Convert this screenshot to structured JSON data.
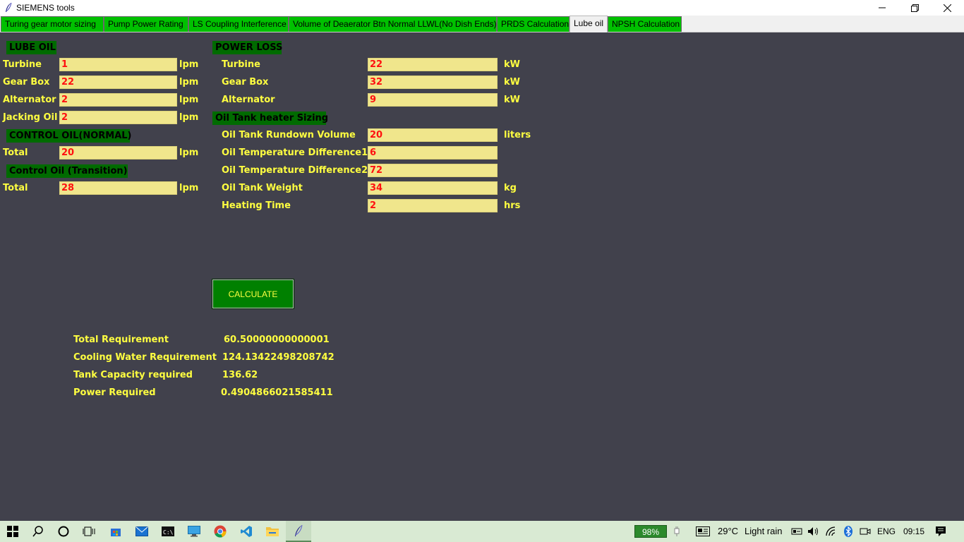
{
  "window": {
    "title": "SIEMENS tools"
  },
  "tabs": [
    "Turing gear motor sizing",
    "Pump Power Rating",
    "LS Coupling Interference",
    "Volume of Deaerator Btn Normal LLWL(No Dish Ends)",
    "PRDS Calculation",
    "Lube oil",
    "NPSH Calculation"
  ],
  "lube_oil": {
    "header": "LUBE OIL",
    "rows": [
      {
        "label": "Turbine",
        "value": "1",
        "unit": "lpm"
      },
      {
        "label": "Gear Box",
        "value": "22",
        "unit": "lpm"
      },
      {
        "label": "Alternator",
        "value": "2",
        "unit": "lpm"
      },
      {
        "label": "Jacking Oil",
        "value": "2",
        "unit": "lpm"
      }
    ]
  },
  "control_oil_normal": {
    "header": "CONTROL OIL(NORMAL)",
    "label": "Total",
    "value": "20",
    "unit": "lpm"
  },
  "control_oil_transition": {
    "header": "Control Oil (Transition)",
    "label": "Total",
    "value": "28",
    "unit": "lpm"
  },
  "power_loss": {
    "header": "POWER LOSS",
    "rows": [
      {
        "label": "Turbine",
        "value": "22",
        "unit": "kW"
      },
      {
        "label": "Gear Box",
        "value": "32",
        "unit": "kW"
      },
      {
        "label": "Alternator",
        "value": "9",
        "unit": "kW"
      }
    ]
  },
  "heater": {
    "header": "Oil Tank heater Sizing",
    "rows": [
      {
        "label": "Oil Tank Rundown Volume",
        "value": "20",
        "unit": "liters"
      },
      {
        "label": "Oil Temperature Difference1",
        "value": "6",
        "unit": ""
      },
      {
        "label": "Oil Temperature Difference2",
        "value": "72",
        "unit": ""
      },
      {
        "label": "Oil Tank Weight",
        "value": "34",
        "unit": "kg"
      },
      {
        "label": "Heating Time",
        "value": "2",
        "unit": "hrs"
      }
    ]
  },
  "calculate_label": "CALCULATE",
  "results": [
    {
      "label": "Total Requirement",
      "value": "60.50000000000001"
    },
    {
      "label": "Cooling Water Requirement",
      "value": "124.13422498208742"
    },
    {
      "label": "Tank Capacity required",
      "value": "136.62"
    },
    {
      "label": "Power Required",
      "value": "0.4904866021585411"
    }
  ],
  "taskbar": {
    "battery": "98%",
    "weather_temp": "29°C",
    "weather_text": "Light rain",
    "language": "ENG",
    "time": "09:15"
  }
}
